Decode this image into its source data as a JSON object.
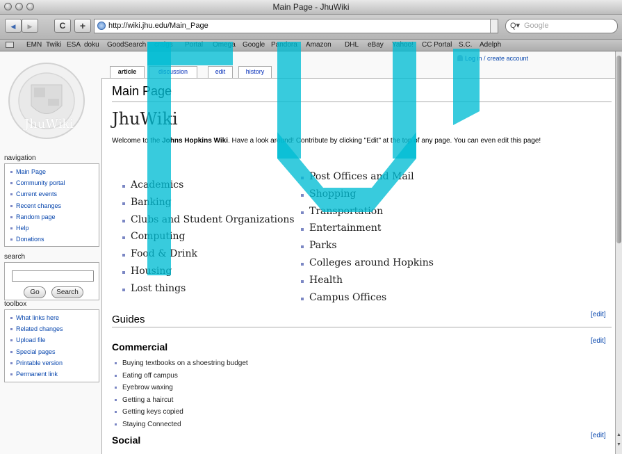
{
  "window": {
    "title": "Main Page - JhuWiki"
  },
  "toolbar": {
    "back_glyph": "◀",
    "forward_glyph": "▶",
    "reload_glyph": "C",
    "add_glyph": "+",
    "url": "http://wiki.jhu.edu/Main_Page",
    "search_placeholder": "Google",
    "search_glyph": "Q▾"
  },
  "bookmarks": [
    "EMN",
    "Twiki",
    "ESA",
    "doku",
    "GoodSearch",
    "craigs",
    "Portal",
    "Omega",
    "Google",
    "Pandora",
    "Amazon",
    "DHL",
    "eBay",
    "Yahoo!",
    "CC Portal",
    "S.C.",
    "Adelph"
  ],
  "logo": {
    "text": "JhuWiki"
  },
  "user_links": {
    "label": "Log in / create account"
  },
  "tabs": [
    {
      "label": "article",
      "selected": true
    },
    {
      "label": "discussion",
      "selected": false
    },
    {
      "label": "edit",
      "selected": false
    },
    {
      "label": "history",
      "selected": false
    }
  ],
  "sidebar": {
    "navigation_title": "navigation",
    "navigation": [
      "Main Page",
      "Community portal",
      "Current events",
      "Recent changes",
      "Random page",
      "Help",
      "Donations"
    ],
    "search_title": "search",
    "go_label": "Go",
    "search_label": "Search",
    "toolbox_title": "toolbox",
    "toolbox": [
      "What links here",
      "Related changes",
      "Upload file",
      "Special pages",
      "Printable version",
      "Permanent link"
    ]
  },
  "main": {
    "page_title": "Main Page",
    "wiki_title": "JhuWiki",
    "intro_before": "Welcome to the ",
    "intro_bold": "Johns Hopkins Wiki",
    "intro_after": ". Have a look around! Contribute by clicking \"Edit\" at the top of any page. You can even edit this page!",
    "left_list": [
      "Academics",
      "Banking",
      "Clubs and Student Organizations",
      "Computing",
      "Food & Drink",
      "Housing",
      "Lost things"
    ],
    "right_list": [
      "Post Offices and Mail",
      "Shopping",
      "Transportation",
      "Entertainment",
      "Parks",
      "Colleges around Hopkins",
      "Health",
      "Campus Offices"
    ],
    "guides_heading": "Guides",
    "commercial_heading": "Commercial",
    "commercial_items": [
      "Buying textbooks on a shoestring budget",
      "Eating off campus",
      "Eyebrow waxing",
      "Getting a haircut",
      "Getting keys copied",
      "Staying Connected"
    ],
    "social_heading": "Social",
    "edit_label": "[edit]"
  },
  "colors": {
    "watermark": "#00bcd4",
    "link": "#0645ad"
  }
}
